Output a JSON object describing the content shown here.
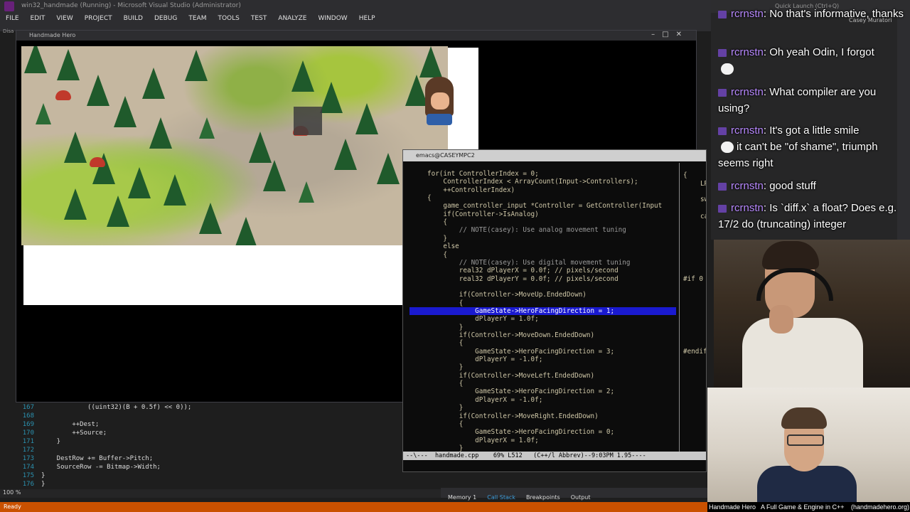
{
  "vs": {
    "title": "win32_handmade (Running) - Microsoft Visual Studio (Administrator)",
    "menu": [
      "FILE",
      "EDIT",
      "VIEW",
      "PROJECT",
      "BUILD",
      "DEBUG",
      "TEAM",
      "TOOLS",
      "TEST",
      "ANALYZE",
      "WINDOW",
      "HELP"
    ],
    "quick_launch": "Quick Launch (Ctrl+Q)",
    "user": "Casey Muratori",
    "side_tab": "Disa",
    "zoom": "100 %",
    "status": "Ready",
    "bottom_tabs": [
      "Memory 1",
      "Call Stack",
      "Breakpoints",
      "Output"
    ],
    "editor_lines": [
      {
        "n": "167",
        "code": "            ((uint32)(B + 0.5f) << 0));"
      },
      {
        "n": "168",
        "code": ""
      },
      {
        "n": "169",
        "code": "        ++Dest;"
      },
      {
        "n": "170",
        "code": "        ++Source;"
      },
      {
        "n": "171",
        "code": "    }"
      },
      {
        "n": "172",
        "code": ""
      },
      {
        "n": "173",
        "code": "    DestRow += Buffer->Pitch;"
      },
      {
        "n": "174",
        "code": "    SourceRow -= Bitmap->Width;"
      },
      {
        "n": "175",
        "code": "}"
      },
      {
        "n": "176",
        "code": "}"
      }
    ]
  },
  "game": {
    "title": "Handmade Hero"
  },
  "emacs": {
    "title": "emacs@CASEYMPC2",
    "modeline": "--\\---  handmade.cpp    69% L512   (C++/l Abbrev)--9:03PM 1.95----",
    "code_lines": [
      "for(int ControllerIndex = 0;",
      "    ControllerIndex < ArrayCount(Input->Controllers);",
      "    ++ControllerIndex)",
      "{",
      "    game_controller_input *Controller = GetController(Input",
      "    if(Controller->IsAnalog)",
      "    {",
      "        // NOTE(casey): Use analog movement tuning",
      "    }",
      "    else",
      "    {",
      "        // NOTE(casey): Use digital movement tuning",
      "        real32 dPlayerX = 0.0f; // pixels/second",
      "        real32 dPlayerY = 0.0f; // pixels/second",
      "",
      "        if(Controller->MoveUp.EndedDown)",
      "        {",
      "            GameState->HeroFacingDirection = 1;",
      "            dPlayerY = 1.0f;",
      "        }",
      "        if(Controller->MoveDown.EndedDown)",
      "        {",
      "            GameState->HeroFacingDirection = 3;",
      "            dPlayerY = -1.0f;",
      "        }",
      "        if(Controller->MoveLeft.EndedDown)",
      "        {",
      "            GameState->HeroFacingDirection = 2;",
      "            dPlayerX = -1.0f;",
      "        }",
      "        if(Controller->MoveRight.EndedDown)",
      "        {",
      "            GameState->HeroFacingDirection = 0;",
      "            dPlayerX = 1.0f;",
      "        }"
    ],
    "right_fragments": [
      "{",
      "LRESU",
      "switch(",
      "case WM",
      "#if 0",
      "#endif"
    ]
  },
  "chat": [
    {
      "user": "rcrnstn",
      "message": "No that's informative, thanks"
    },
    {
      "user": "rcrnstn",
      "message": "Oh yeah Odin, I forgot"
    },
    {
      "user": "rcrnstn",
      "message": "What compiler are you using?"
    },
    {
      "user": "rcrnstn",
      "message": "It's got a little smile"
    },
    {
      "user": "",
      "message": "it can't be \"of shame\", triumph seems right"
    },
    {
      "user": "rcrnstn",
      "message": "good stuff"
    },
    {
      "user": "rcrnstn",
      "message": "Is `diff.x` a float? Does e.g. 17/2 do (truncating) integer"
    }
  ],
  "stream_footer": {
    "left": "Handmade Hero",
    "middle": "A Full Game & Engine in C++",
    "right": "(handmadehero.org)"
  }
}
